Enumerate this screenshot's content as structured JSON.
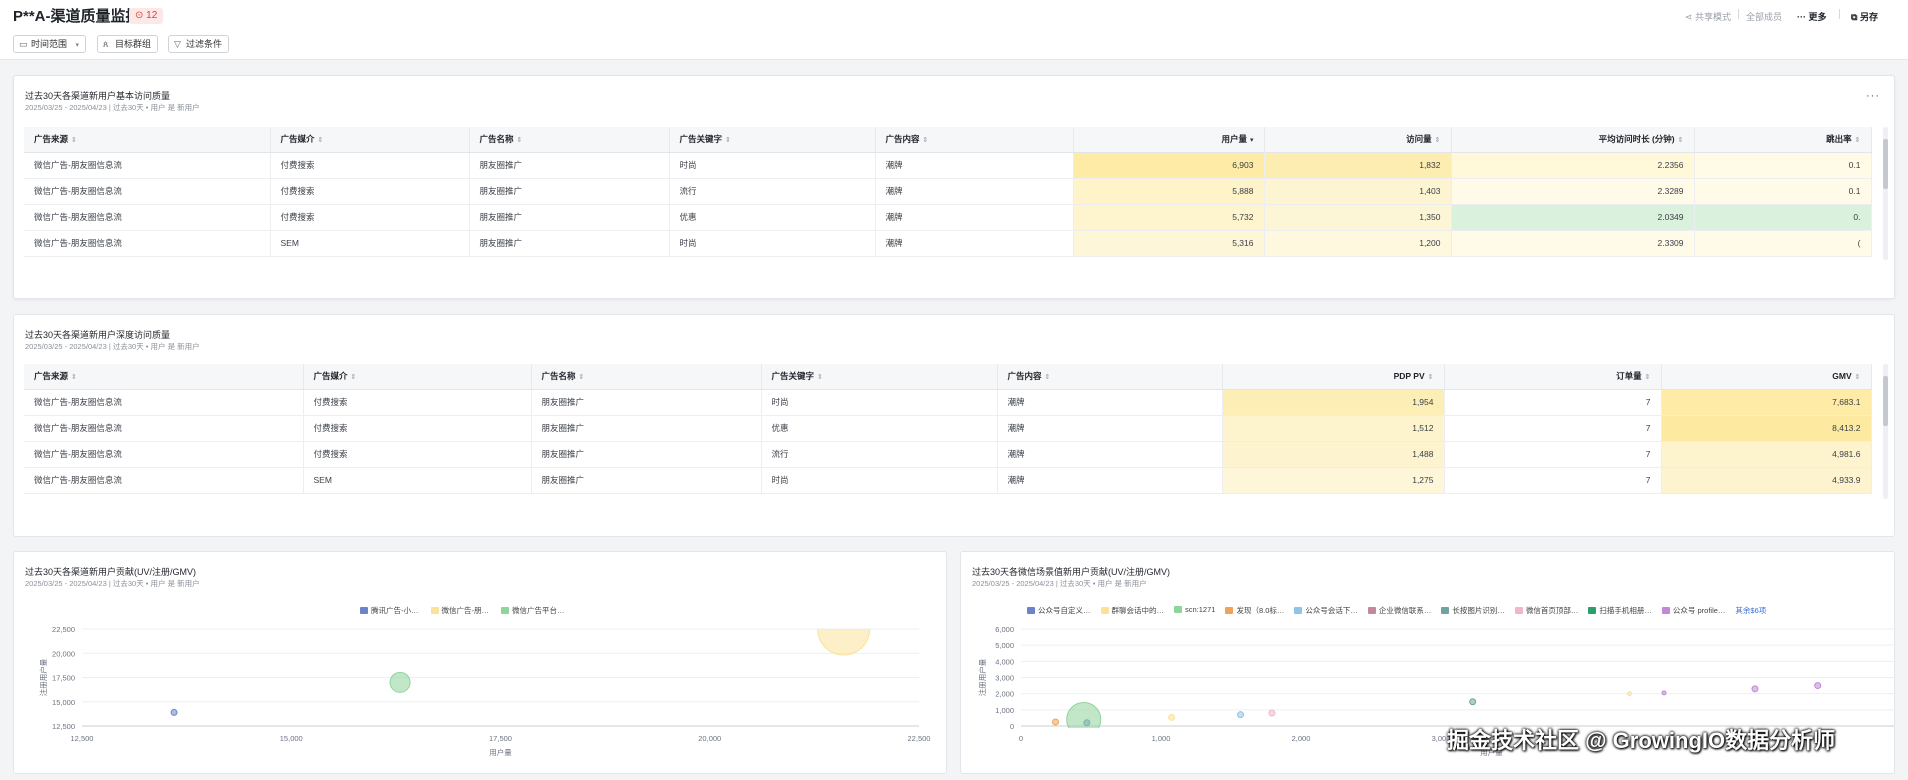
{
  "header": {
    "title": "P**A-渠道质量监控",
    "badge": "⊙ 12",
    "filters": [
      "时间范围",
      "目标群组",
      "过滤条件"
    ],
    "share": "共享模式",
    "share_scope": "全部成员",
    "more": "更多",
    "save_as": "另存"
  },
  "table1": {
    "title": "过去30天各渠道新用户基本访问质量",
    "subtitle": "2025/03/25 - 2025/04/23 | 过去30天 • 用户 是 新用户",
    "columns": [
      "广告来源",
      "广告媒介",
      "广告名称",
      "广告关键字",
      "广告内容",
      "用户量",
      "访问量",
      "平均访问时长 (分钟)",
      "跳出率"
    ],
    "rows": [
      [
        "微信广告-朋友圈信息流",
        "付费搜索",
        "朋友圈推广",
        "时尚",
        "潮牌",
        "6,903",
        "1,832",
        "2.2356",
        "0.1"
      ],
      [
        "微信广告-朋友圈信息流",
        "付费搜索",
        "朋友圈推广",
        "流行",
        "潮牌",
        "5,888",
        "1,403",
        "2.3289",
        "0.1"
      ],
      [
        "微信广告-朋友圈信息流",
        "付费搜索",
        "朋友圈推广",
        "优惠",
        "潮牌",
        "5,732",
        "1,350",
        "2.0349",
        "0."
      ],
      [
        "微信广告-朋友圈信息流",
        "SEM",
        "朋友圈推广",
        "时尚",
        "潮牌",
        "5,316",
        "1,200",
        "2.3309",
        "("
      ]
    ],
    "cell_colors": [
      [
        null,
        null,
        null,
        null,
        null,
        "#fdeba6",
        "#fdedb0",
        "#fff8d9",
        "#fffbe6"
      ],
      [
        null,
        null,
        null,
        null,
        null,
        "#fef3c9",
        "#fdf5d2",
        "#fffbe8",
        "#fffbe8"
      ],
      [
        null,
        null,
        null,
        null,
        null,
        "#fef4cd",
        "#fdf6d6",
        "#daf1de",
        "#daf1de"
      ],
      [
        null,
        null,
        null,
        null,
        null,
        "#fef6d8",
        "#fef8de",
        "#fffbe8",
        "#fffbe8"
      ]
    ]
  },
  "table2": {
    "title": "过去30天各渠道新用户深度访问质量",
    "subtitle": "2025/03/25 - 2025/04/23 | 过去30天 • 用户 是 新用户",
    "columns": [
      "广告来源",
      "广告媒介",
      "广告名称",
      "广告关键字",
      "广告内容",
      "PDP PV",
      "订单量",
      "GMV"
    ],
    "rows": [
      [
        "微信广告-朋友圈信息流",
        "付费搜索",
        "朋友圈推广",
        "时尚",
        "潮牌",
        "1,954",
        "7",
        "7,683.1"
      ],
      [
        "微信广告-朋友圈信息流",
        "付费搜索",
        "朋友圈推广",
        "优惠",
        "潮牌",
        "1,512",
        "7",
        "8,413.2"
      ],
      [
        "微信广告-朋友圈信息流",
        "付费搜索",
        "朋友圈推广",
        "流行",
        "潮牌",
        "1,488",
        "7",
        "4,981.6"
      ],
      [
        "微信广告-朋友圈信息流",
        "SEM",
        "朋友圈推广",
        "时尚",
        "潮牌",
        "1,275",
        "7",
        "4,933.9"
      ]
    ],
    "cell_colors": [
      [
        null,
        null,
        null,
        null,
        null,
        "#fdeeb6",
        null,
        "#fdeba6"
      ],
      [
        null,
        null,
        null,
        null,
        null,
        "#fdf3cc",
        null,
        "#fde9a0"
      ],
      [
        null,
        null,
        null,
        null,
        null,
        "#fdf4cf",
        null,
        "#fdf3cc"
      ],
      [
        null,
        null,
        null,
        null,
        null,
        "#fef6d8",
        null,
        "#fdf4cf"
      ]
    ]
  },
  "chart_data": [
    {
      "type": "scatter",
      "title": "过去30天各渠道新用户贡献(UV/注册/GMV)",
      "subtitle": "2025/03/25 - 2025/04/23 | 过去30天 • 用户 是 新用户",
      "xlabel": "用户量",
      "ylabel": "注册用户量",
      "xlim": [
        12500,
        22500
      ],
      "ylim": [
        12500,
        22500
      ],
      "xticks": [
        "12,500",
        "15,000",
        "17,500",
        "20,000",
        "22,500"
      ],
      "yticks": [
        "12,500",
        "15,000",
        "17,500",
        "20,000",
        "22,500"
      ],
      "legend": [
        "腾讯广告-小…",
        "微信广告-朋…",
        "微信广告平台…"
      ],
      "legend_position": "top",
      "series": [
        {
          "name": "腾讯广告-小…",
          "color": "#6b83c9",
          "points": [
            {
              "x": 13600,
              "y": 13900,
              "size": 3
            }
          ]
        },
        {
          "name": "微信广告-朋…",
          "color": "#fbe29a",
          "points": [
            {
              "x": 21600,
              "y": 22500,
              "size": 26
            }
          ]
        },
        {
          "name": "微信广告平台…",
          "color": "#8fd49a",
          "points": [
            {
              "x": 16300,
              "y": 17000,
              "size": 10
            }
          ]
        }
      ]
    },
    {
      "type": "scatter",
      "title": "过去30天各微信场景值新用户贡献(UV/注册/GMV)",
      "subtitle": "2025/03/25 - 2025/04/23 | 过去30天 • 用户 是 新用户",
      "xlabel": "用户量",
      "ylabel": "注册用户量",
      "xlim": [
        0,
        3000
      ],
      "ylim": [
        0,
        6000
      ],
      "xticks": [
        "0",
        "1,000",
        "2,000",
        "3,000"
      ],
      "yticks": [
        "0",
        "1,000",
        "2,000",
        "3,000",
        "4,000",
        "5,000",
        "6,000"
      ],
      "legend": [
        "公众号自定义…",
        "群聊会话中的…",
        "scn:1271",
        "发现（8.0标…",
        "公众号会话下…",
        "企业微信联系…",
        "长按图片识别…",
        "微信首页顶部…",
        "扫描手机相册…",
        "公众号 profile…",
        "其余$6项"
      ],
      "legend_position": "top",
      "series": [
        {
          "name": "公众号自定义…",
          "color": "#6b83c9",
          "points": [
            {
              "x": 210,
              "y": 200,
              "size": 3
            }
          ]
        },
        {
          "name": "群聊会话中的…",
          "color": "#fbe29a",
          "points": [
            {
              "x": 480,
              "y": 530,
              "size": 3
            },
            {
              "x": 1940,
              "y": 2000,
              "size": 2
            },
            {
              "x": 3500,
              "y": 3500,
              "size": 3
            }
          ]
        },
        {
          "name": "scn:1271",
          "color": "#8fd49a",
          "points": [
            {
              "x": 200,
              "y": 400,
              "size": 17
            }
          ]
        },
        {
          "name": "发现（8.0标…",
          "color": "#f0a355",
          "points": [
            {
              "x": 110,
              "y": 250,
              "size": 3
            }
          ]
        },
        {
          "name": "公众号会话下…",
          "color": "#8ec5e6",
          "points": [
            {
              "x": 700,
              "y": 700,
              "size": 3
            }
          ]
        },
        {
          "name": "企业微信联系…",
          "color": "#c3889a",
          "points": [
            {
              "x": 3140,
              "y": 3250,
              "size": 17
            }
          ]
        },
        {
          "name": "长按图片识别…",
          "color": "#6fa3a0",
          "points": [
            {
              "x": 1440,
              "y": 1500,
              "size": 3
            }
          ]
        },
        {
          "name": "微信首页顶部…",
          "color": "#f0b8c4",
          "points": [
            {
              "x": 800,
              "y": 800,
              "size": 3
            }
          ]
        },
        {
          "name": "扫描手机相册…",
          "color": "#2e9e6b",
          "points": [
            {
              "x": 5440,
              "y": 6000,
              "size": 26
            }
          ]
        },
        {
          "name": "公众号 profile…",
          "color": "#c287d6",
          "points": [
            {
              "x": 2340,
              "y": 2300,
              "size": 3
            },
            {
              "x": 2540,
              "y": 2500,
              "size": 3
            },
            {
              "x": 2050,
              "y": 2050,
              "size": 2
            }
          ]
        }
      ]
    }
  ],
  "watermark": "掘金技术社区 @ GrowingIO数据分析师"
}
